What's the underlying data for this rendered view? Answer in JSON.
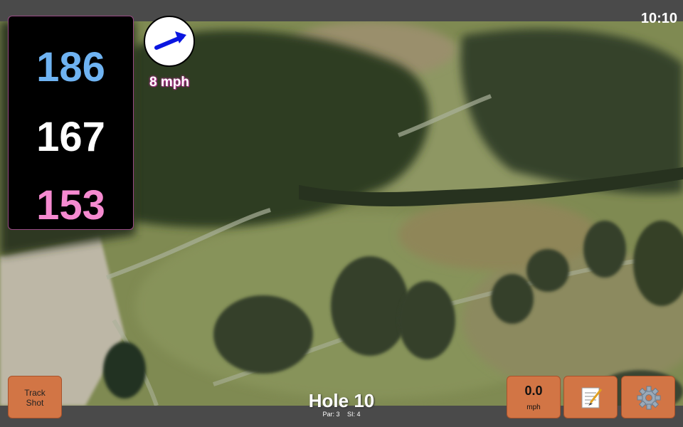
{
  "status": {
    "time": "10:10"
  },
  "yardage": {
    "back": "186",
    "middle": "167",
    "front": "153"
  },
  "wind": {
    "speed_text": "8 mph",
    "icon": "wind-direction-arrow-icon"
  },
  "buttons": {
    "track_shot": "Track\nShot",
    "speed_value": "0.0",
    "speed_unit": "mph",
    "notes_icon": "notepad-icon",
    "settings_icon": "gear-icon"
  },
  "hole": {
    "title": "Hole 10",
    "par": "Par: 3",
    "si": "SI: 4"
  },
  "colors": {
    "back": "#6fb3f2",
    "middle": "#ffffff",
    "front": "#f58ad0",
    "button": "#d27545",
    "wind_arrow": "#0a16e0"
  }
}
